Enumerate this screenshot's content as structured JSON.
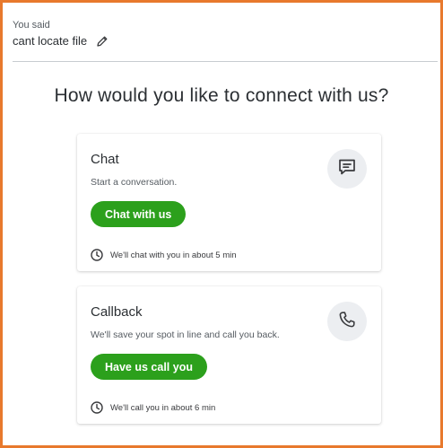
{
  "conversation": {
    "you_said_label": "You said",
    "query": "cant locate file"
  },
  "heading": "How would you like to connect with us?",
  "options": [
    {
      "title": "Chat",
      "description": "Start a conversation.",
      "button_label": "Chat with us",
      "wait_text": "We'll chat with you in about 5 min",
      "icon": "chat-bubble-icon"
    },
    {
      "title": "Callback",
      "description": "We'll save your spot in line and call you back.",
      "button_label": "Have us call you",
      "wait_text": "We'll call you in about 6 min",
      "icon": "phone-icon"
    }
  ],
  "colors": {
    "frame_border": "#e8792d",
    "button_green": "#2ca01c",
    "icon_circle_bg": "#eceef1"
  }
}
